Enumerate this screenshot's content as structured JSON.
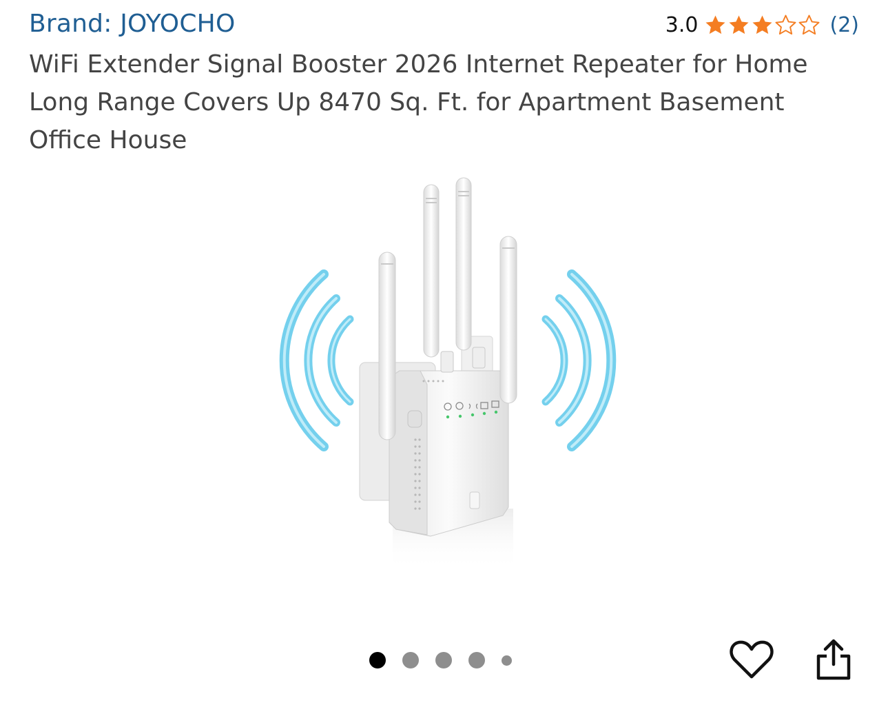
{
  "product": {
    "brand": "Brand: JOYOCHO",
    "rating_value": "3.0",
    "rating_stars": 3,
    "rating_count": "(2)",
    "title": "WiFi Extender Signal Booster 2026 Internet Repeater for Home Long Range Covers Up 8470 Sq. Ft. for Apartment Basement Office House"
  },
  "gallery": {
    "image_icon": "wifi-extender-image",
    "total_images": 5,
    "active_index": 0
  },
  "actions": {
    "favorite_icon": "heart-icon",
    "share_icon": "share-icon"
  },
  "colors": {
    "link": "#1f5e93",
    "star": "#f47d22",
    "title_text": "#444444",
    "dot_active": "#000000",
    "dot_inactive": "#8e8e8e"
  }
}
